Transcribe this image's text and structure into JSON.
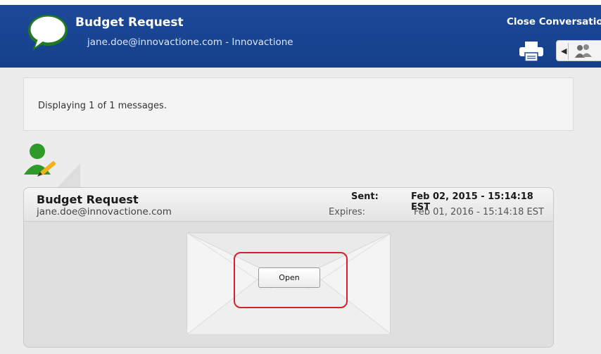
{
  "header": {
    "title": "Budget Request",
    "subtitle": "jane.doe@innovactione.com - Innovactione",
    "close_label": "Close Conversation",
    "icons": [
      "chat-bubble-icon",
      "print-icon",
      "chevron-left-icon",
      "people-icon"
    ],
    "colors": {
      "bar": "#1c4a9a",
      "text": "#ffffff"
    }
  },
  "info": {
    "text": "Displaying 1 of 1 messages."
  },
  "message": {
    "title": "Budget Request",
    "from": "jane.doe@innovactione.com",
    "sent_label": "Sent:",
    "sent_value": "Feb 02, 2015 - 15:14:18 EST",
    "expires_label": "Expires:",
    "expires_value": "Feb 01, 2016 - 15:14:18 EST",
    "open_label": "Open",
    "highlight_color": "#d4202a"
  }
}
